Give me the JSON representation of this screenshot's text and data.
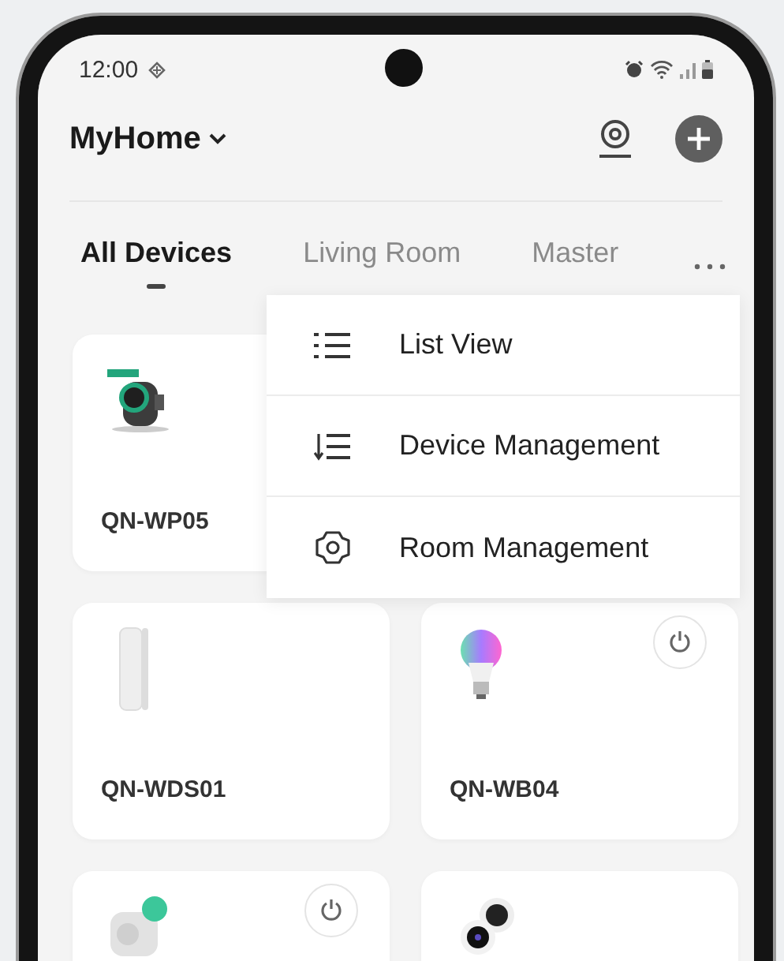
{
  "status_bar": {
    "time": "12:00"
  },
  "header": {
    "home_name": "MyHome"
  },
  "tabs": [
    {
      "label": "All Devices",
      "selected": true
    },
    {
      "label": "Living Room",
      "selected": false
    },
    {
      "label": "Master",
      "selected": false
    }
  ],
  "menu": [
    {
      "label": "List View",
      "kind": "list"
    },
    {
      "label": "Device Management",
      "kind": "sort"
    },
    {
      "label": "Room Management",
      "kind": "settings"
    }
  ],
  "devices": [
    {
      "name": "QN-WP05",
      "kind": "valve"
    },
    {
      "name": "QN-WDS01",
      "kind": "sensor",
      "power_button": false
    },
    {
      "name": "QN-WB04",
      "kind": "bulb",
      "power_button": true
    },
    {
      "kind": "plug",
      "power_button": true
    },
    {
      "kind": "camera"
    }
  ]
}
